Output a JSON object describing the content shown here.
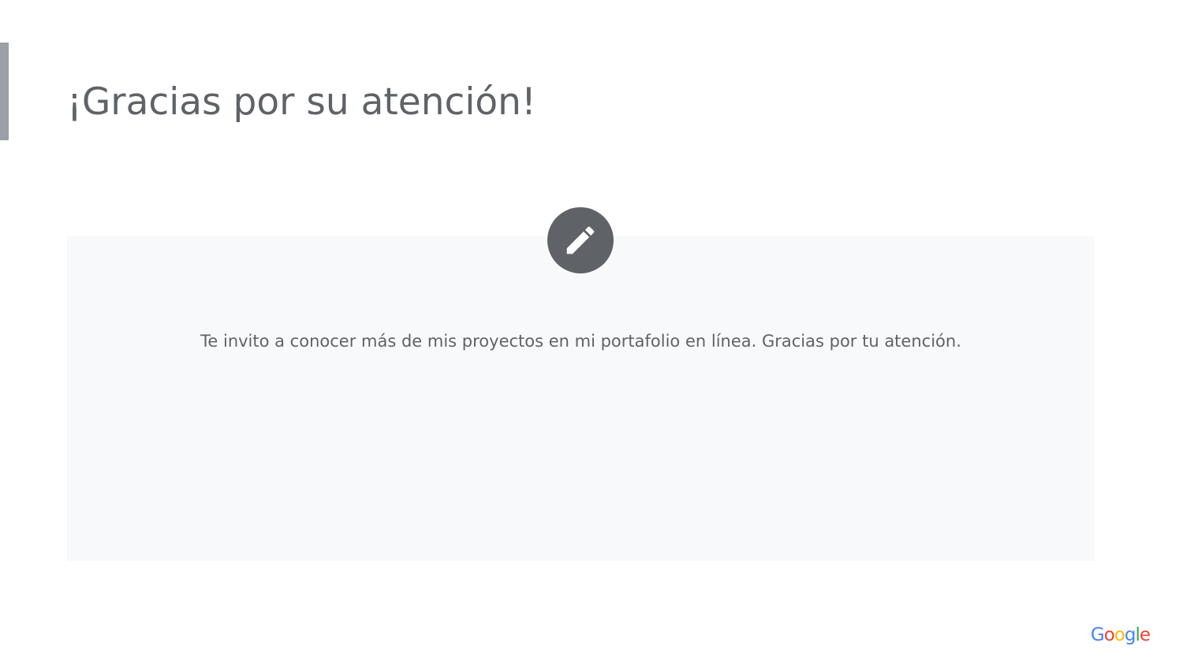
{
  "slide": {
    "title": "¡Gracias por su atención!",
    "body_text": "Te invito a conocer más de mis proyectos en mi portafolio en línea. Gracias por tu atención."
  },
  "icons": {
    "badge": "pencil-icon"
  },
  "logo": {
    "letters": [
      "G",
      "o",
      "o",
      "g",
      "l",
      "e"
    ],
    "colors": [
      "#4285f4",
      "#ea4335",
      "#fbbc05",
      "#4285f4",
      "#34a853",
      "#ea4335"
    ]
  },
  "colors": {
    "text": "#5f6368",
    "panel": "#f8f9fa",
    "accent_bar": "#9aa0a6",
    "badge": "#5f6368"
  }
}
